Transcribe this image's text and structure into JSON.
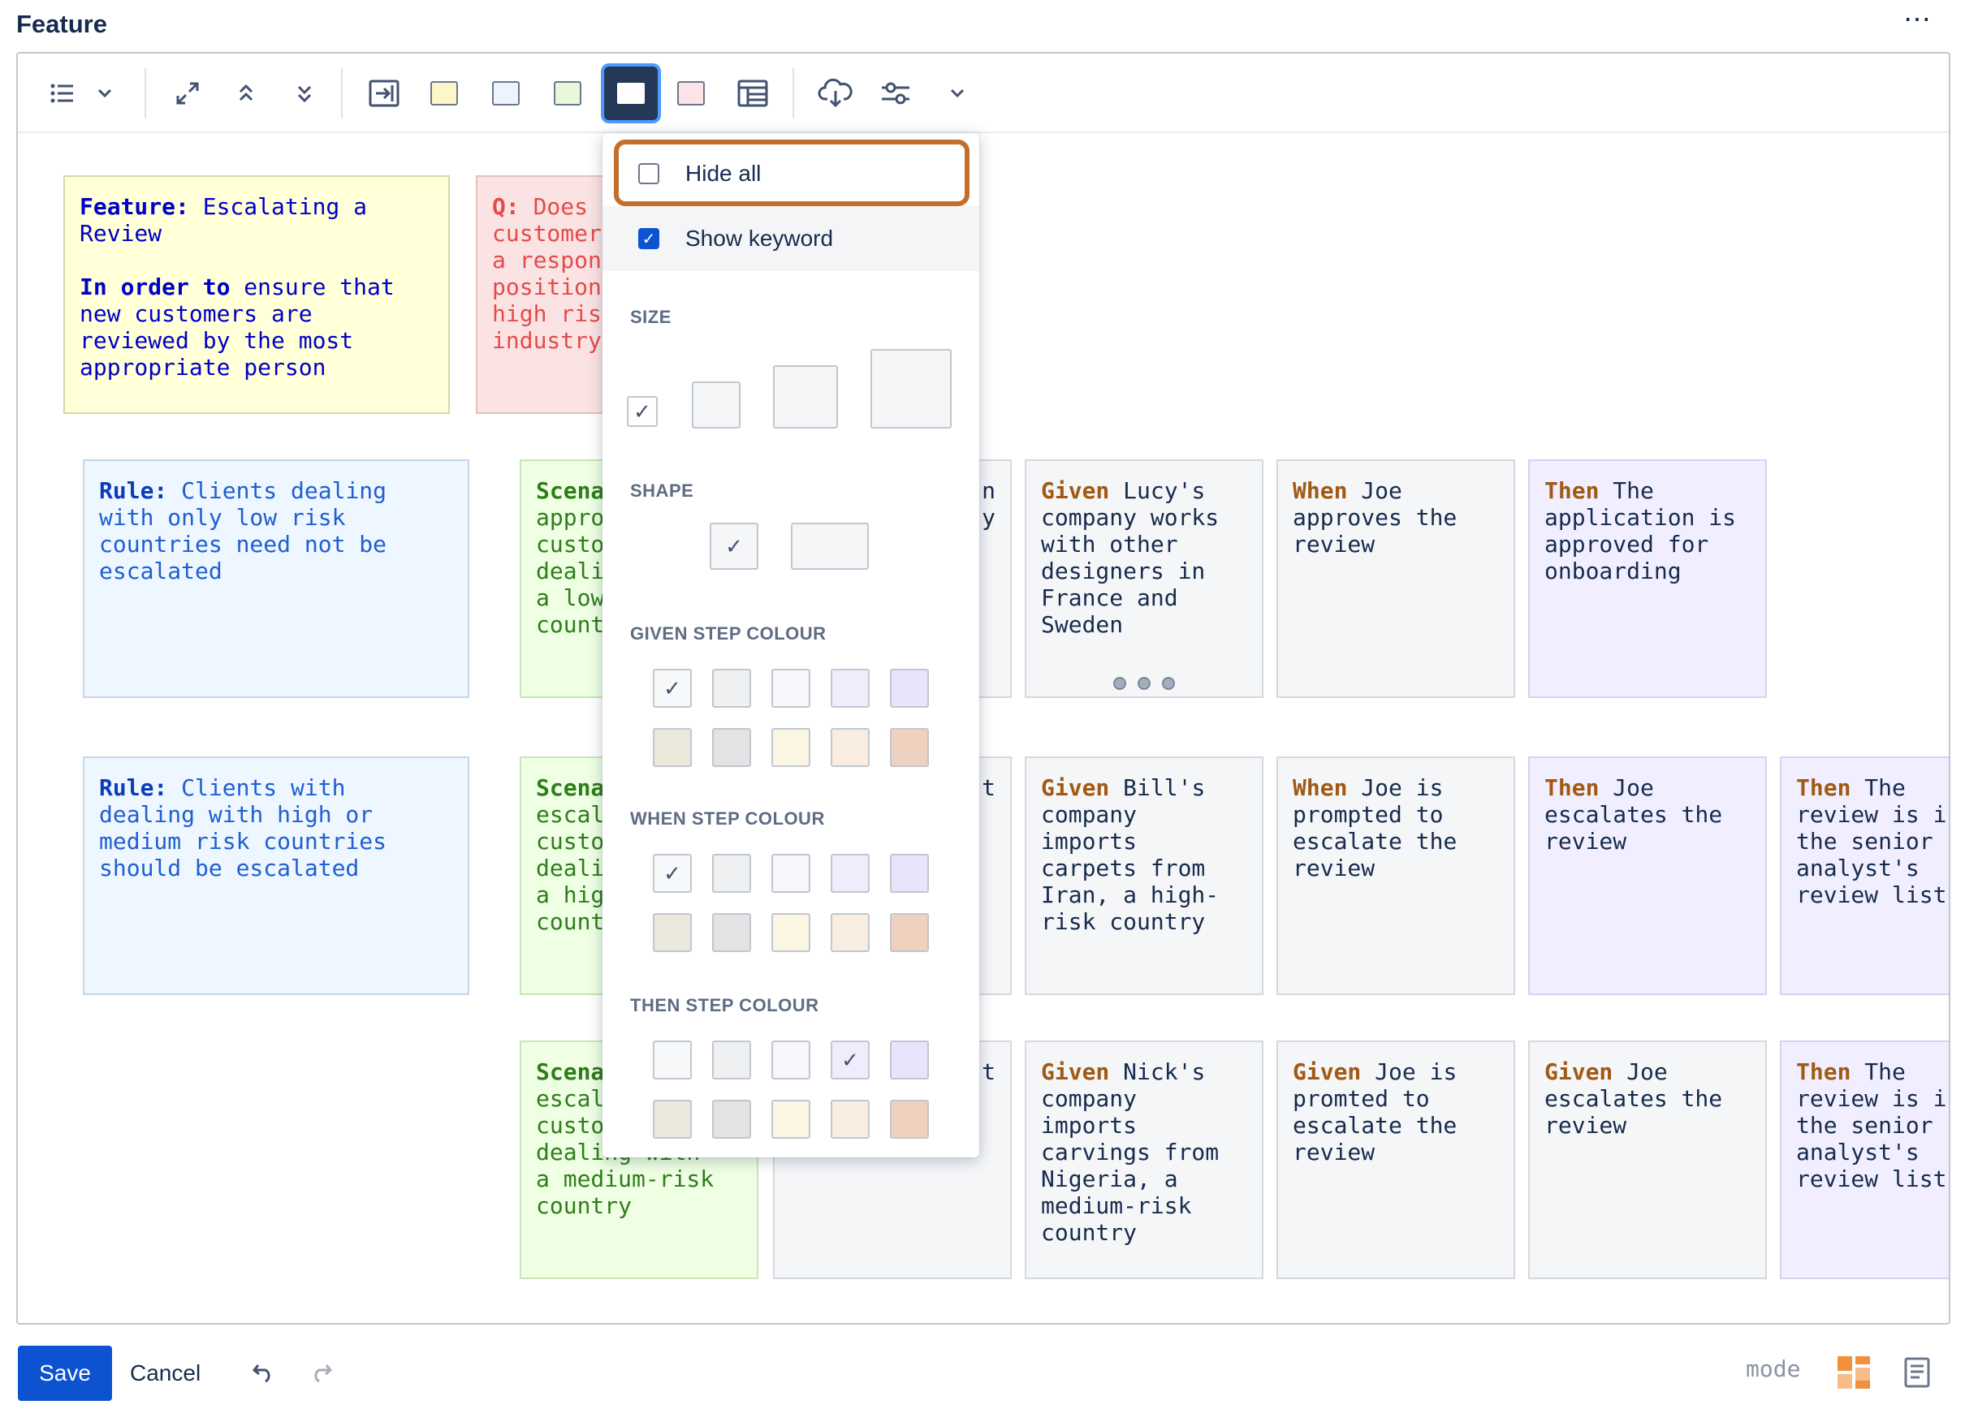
{
  "header": {
    "title": "Feature",
    "more": "⋯"
  },
  "toolbar": {
    "icons": [
      "list-icon",
      "chevron-down-icon",
      "expand-icon",
      "collapse-up-icon",
      "expand-down-icon",
      "export-icon",
      "yellow-swatch",
      "blue-swatch",
      "green-swatch",
      "card-style-icon",
      "pink-swatch",
      "table-icon",
      "cloud-download-icon",
      "settings-sliders-icon",
      "chevron-down-icon"
    ],
    "colors": {
      "yellow": "#fdf7c8",
      "blue": "#eef4ff",
      "green": "#e9f8d9",
      "pink": "#fbe3e8",
      "active": "#253858"
    }
  },
  "dropdown": {
    "hide_all": "Hide all",
    "show_keyword": "Show keyword",
    "size_label": "SIZE",
    "shape_label": "SHAPE",
    "given_label": "GIVEN STEP COLOUR",
    "when_label": "WHEN STEP COLOUR",
    "then_label": "THEN STEP COLOUR",
    "swatch_colors": [
      "#f7f8f9",
      "#eef0f2",
      "#f6f6fb",
      "#efedfb",
      "#e7e4fb",
      "#ebe8dc",
      "#e3e3e3",
      "#fbf5e4",
      "#f9ede2",
      "#eed2bf"
    ]
  },
  "cards": {
    "feature": {
      "kw": "Feature:",
      "title": " Escalating a\nReview",
      "kw2": "In order to",
      "body": " ensure that\nnew customers are\nreviewed by the most\nappropriate person"
    },
    "question": {
      "kw": "Q:",
      "text": " Does\ncustomer\na respon\nposition\nhigh ris\nindustry"
    },
    "rule1": {
      "kw": "Rule:",
      "text": " Clients dealing\nwith only low risk\ncountries need not be\nescalated"
    },
    "rule2": {
      "kw": "Rule:",
      "text": " Clients with\ndealing with high or\nmedium risk countries\nshould be escalated"
    },
    "scen1": {
      "kw": "Scena",
      "text": "\nappro\ncusto\ndeali\na low\ncount"
    },
    "scen2": {
      "kw": "Scena",
      "text": "\nescal\ncusto\ndeali\na hig\ncount"
    },
    "scen3": {
      "kw": "Scena",
      "text": "\nescal\ncusto\ndealing with\na medium-risk\ncountry"
    },
    "partial1": {
      "text": "n\ny"
    },
    "partial2": {
      "text": "t"
    },
    "partial3": {
      "text": "t"
    },
    "row1": [
      {
        "kw": "Given",
        "text": " Lucy's\ncompany works\nwith other\ndesigners in\nFrance and\nSweden"
      },
      {
        "kw": "When",
        "text": " Joe\napproves the\nreview"
      },
      {
        "kw": "Then",
        "text": " The\napplication is\napproved for\nonboarding"
      }
    ],
    "row2": [
      {
        "kw": "Given",
        "text": " Bill's\ncompany\nimports\ncarpets from\nIran, a high-\nrisk country"
      },
      {
        "kw": "When",
        "text": " Joe is\nprompted to\nescalate the\nreview"
      },
      {
        "kw": "Then",
        "text": " Joe\nescalates the\nreview"
      },
      {
        "kw": "Then",
        "text": " The\nreview is i\nthe senior\nanalyst's\nreview list"
      }
    ],
    "row3": [
      {
        "kw": "Given",
        "text": " Nick's\ncompany\nimports\ncarvings from\nNigeria, a\nmedium-risk\ncountry"
      },
      {
        "kw": "Given",
        "text": " Joe is\npromted to\nescalate the\nreview"
      },
      {
        "kw": "Given",
        "text": " Joe\nescalates the\nreview"
      },
      {
        "kw": "Then",
        "text": " The\nreview is i\nthe senior\nanalyst's\nreview list"
      }
    ]
  },
  "footer": {
    "save": "Save",
    "cancel": "Cancel",
    "mode": "mode"
  }
}
